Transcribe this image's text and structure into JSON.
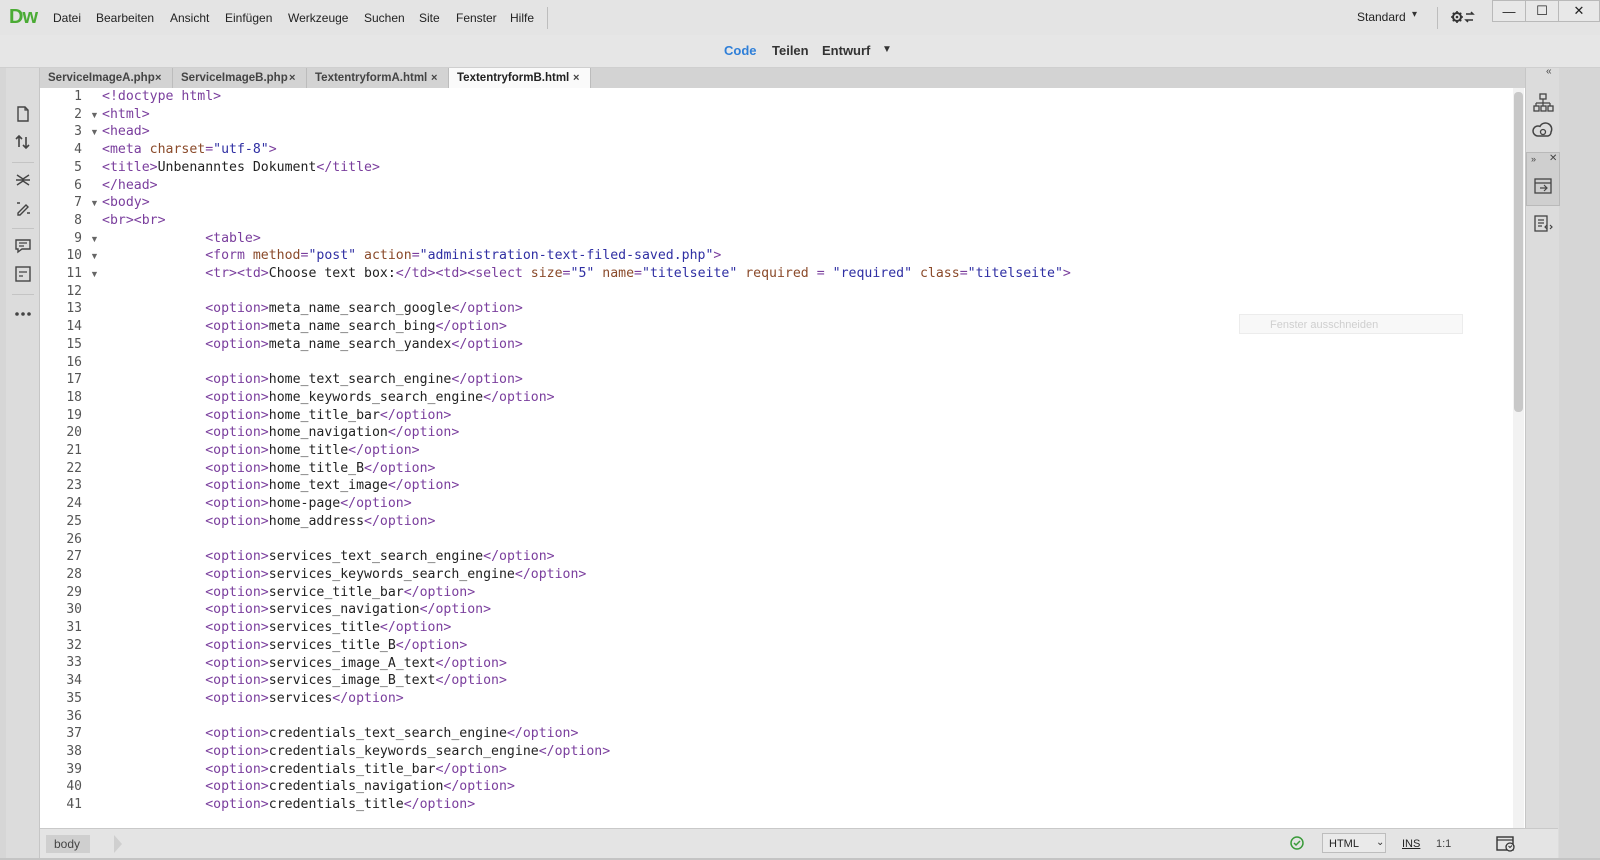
{
  "app": {
    "logo": "Dw",
    "menu": [
      "Datei",
      "Bearbeiten",
      "Ansicht",
      "Einfügen",
      "Werkzeuge",
      "Suchen",
      "Site",
      "Fenster",
      "Hilfe"
    ],
    "workspace": "Standard",
    "window_controls": {
      "minimize": "—",
      "maximize": "☐",
      "close": "✕"
    }
  },
  "viewbar": {
    "code": "Code",
    "split": "Teilen",
    "design": "Entwurf"
  },
  "tabs": [
    {
      "label": "ServiceImageA.php",
      "active": false
    },
    {
      "label": "ServiceImageB.php",
      "active": false
    },
    {
      "label": "TextentryformA.html",
      "active": false
    },
    {
      "label": "TextentryformB.html",
      "active": true
    }
  ],
  "tab_close_glyph": "×",
  "editor": {
    "lines": [
      "1",
      "2",
      "3",
      "4",
      "5",
      "6",
      "7",
      "8",
      "9",
      "10",
      "11",
      "12",
      "13",
      "14",
      "15",
      "16",
      "17",
      "18",
      "19",
      "20",
      "21",
      "22",
      "23",
      "24",
      "25",
      "26",
      "27",
      "28",
      "29",
      "30",
      "31",
      "32",
      "33",
      "34",
      "35",
      "36",
      "37",
      "38",
      "39",
      "40",
      "41"
    ],
    "fold_lines": [
      "2",
      "3",
      "7",
      "9",
      "10",
      "11"
    ],
    "fold_glyph": "▼",
    "code": {
      "l1": "<!doctype html>",
      "l2": "<html>",
      "l3": "<head>",
      "l4_tag": "<meta ",
      "l4_attr": "charset",
      "l4_eq": "=",
      "l4_val": "\"utf-8\"",
      "l4_end": ">",
      "l5_open": "<title>",
      "l5_text": "Unbenanntes Dokument",
      "l5_close": "</title>",
      "l6": "</head>",
      "l7": "<body>",
      "l8": "<br><br>",
      "l9": "<table>",
      "l10_tag": "<form ",
      "l10_a1": "method",
      "l10_v1": "\"post\"",
      "l10_a2": "action",
      "l10_v2": "\"administration-text-filed-saved.php\"",
      "l11_open": "<tr><td>",
      "l11_text": "Choose text box:",
      "l11_mid": "</td><td><select ",
      "l11_a1": "size",
      "l11_v1": "\"5\"",
      "l11_a2": "name",
      "l11_v2": "\"titelseite\"",
      "l11_a3": "required",
      "l11_v3": "\"required\"",
      "l11_a4": "class",
      "l11_v4": "\"titelseite\"",
      "opt_open": "<option>",
      "opt_close": "</option>",
      "options": {
        "13": "meta_name_search_google",
        "14": "meta_name_search_bing",
        "15": "meta_name_search_yandex",
        "17": "home_text_search_engine",
        "18": "home_keywords_search_engine",
        "19": "home_title_bar",
        "20": "home_navigation",
        "21": "home_title",
        "22": "home_title_B",
        "23": "home_text_image",
        "24": "home-page",
        "25": "home_address",
        "27": "services_text_search_engine",
        "28": "services_keywords_search_engine",
        "29": "service_title_bar",
        "30": "services_navigation",
        "31": "services_title",
        "32": "services_title_B",
        "33": "services_image_A_text",
        "34": "services_image_B_text",
        "35": "services",
        "37": "credentials_text_search_engine",
        "38": "credentials_keywords_search_engine",
        "39": "credentials_title_bar",
        "40": "credentials_navigation",
        "41": "credentials_title"
      }
    }
  },
  "ghost_tooltip": "Fenster ausschneiden",
  "statusbar": {
    "tag": "body",
    "doctype": "HTML",
    "mode": "INS",
    "position": "1:1"
  },
  "colors": {
    "accent": "#2f7fd8",
    "logo": "#4bab35",
    "tag": "#7a3e9d",
    "attr": "#8a4a2a",
    "value": "#2f2fa3"
  }
}
